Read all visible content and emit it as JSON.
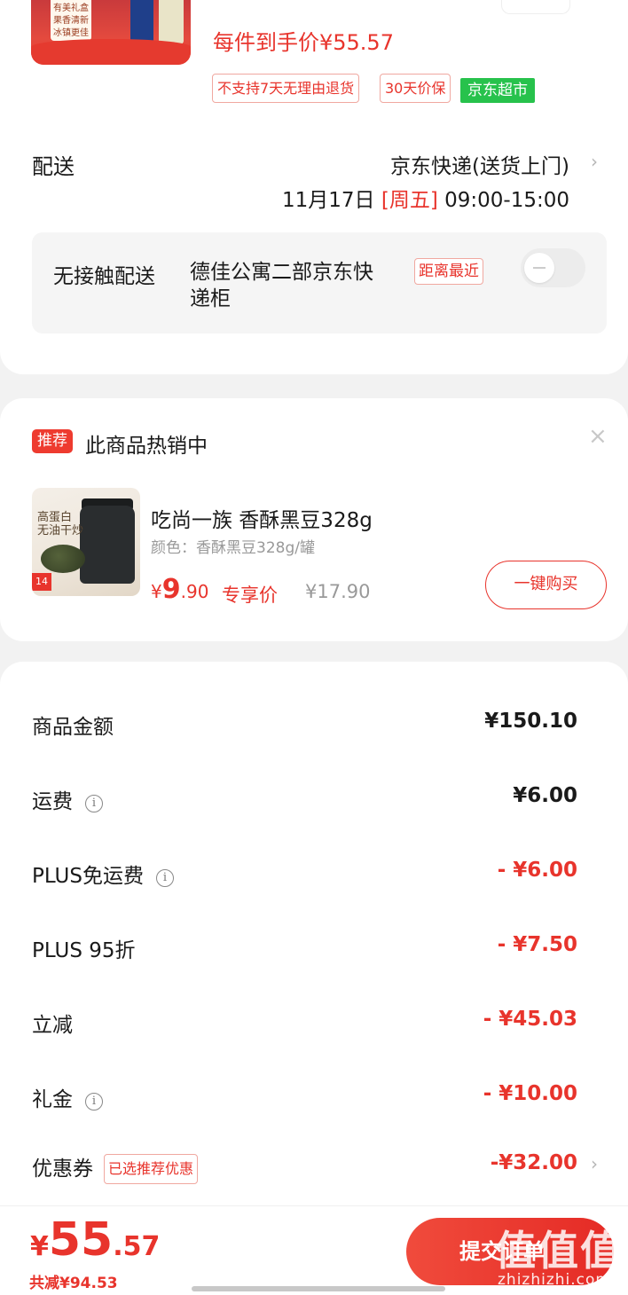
{
  "top_product": {
    "thumb_text": "有美礼盒\n果香清新\n冰镇更佳",
    "unit_price": "每件到手价¥55.57",
    "chips": [
      "不支持7天无理由退货",
      "30天价保"
    ],
    "store_badge": "京东超市"
  },
  "delivery": {
    "label": "配送",
    "method": "京东快递(送货上门)",
    "date": "11月17日",
    "weekday": "[周五]",
    "time": "09:00-15:00",
    "contactless": {
      "label": "无接触配送",
      "address": "德佳公寓二部京东快递柜",
      "nearest_tag": "距离最近",
      "enabled": false
    }
  },
  "recommend": {
    "badge": "推荐",
    "title": "此商品热销中",
    "product": {
      "name": "吃尚一族 香酥黑豆328g",
      "spec": "颜色：香酥黑豆328g/罐",
      "price_symbol": "¥",
      "price_int": "9",
      "price_dec": ".90",
      "price_tag": "专享价",
      "old_price": "¥17.90",
      "img_text": "高蛋白\n无油干炒",
      "img_badge": "14",
      "buy_label": "一键购买"
    }
  },
  "summary": {
    "rows": [
      {
        "label": "商品金额",
        "value": "¥150.10",
        "info": false,
        "discount": false
      },
      {
        "label": "运费",
        "value": "¥6.00",
        "info": true,
        "discount": false
      },
      {
        "label": "PLUS免运费",
        "value": "- ¥6.00",
        "info": true,
        "discount": true
      },
      {
        "label": "PLUS 95折",
        "value": "- ¥7.50",
        "info": false,
        "discount": true
      },
      {
        "label": "立减",
        "value": "- ¥45.03",
        "info": false,
        "discount": true
      },
      {
        "label": "礼金",
        "value": "- ¥10.00",
        "info": true,
        "discount": true
      }
    ],
    "coupon": {
      "label": "优惠券",
      "chip": "已选推荐优惠",
      "value": "-¥32.00"
    }
  },
  "bottom": {
    "currency": "¥",
    "total_int": "55",
    "total_dec": ".57",
    "saved": "共减¥94.53",
    "submit_label": "提交订单",
    "watermark": "值值值",
    "watermark_sub": "zhizhizhi.com"
  },
  "colors": {
    "accent": "#e8342c",
    "green": "#27c24c"
  },
  "icons": [
    "chevron-right-icon",
    "info-icon",
    "close-icon"
  ]
}
